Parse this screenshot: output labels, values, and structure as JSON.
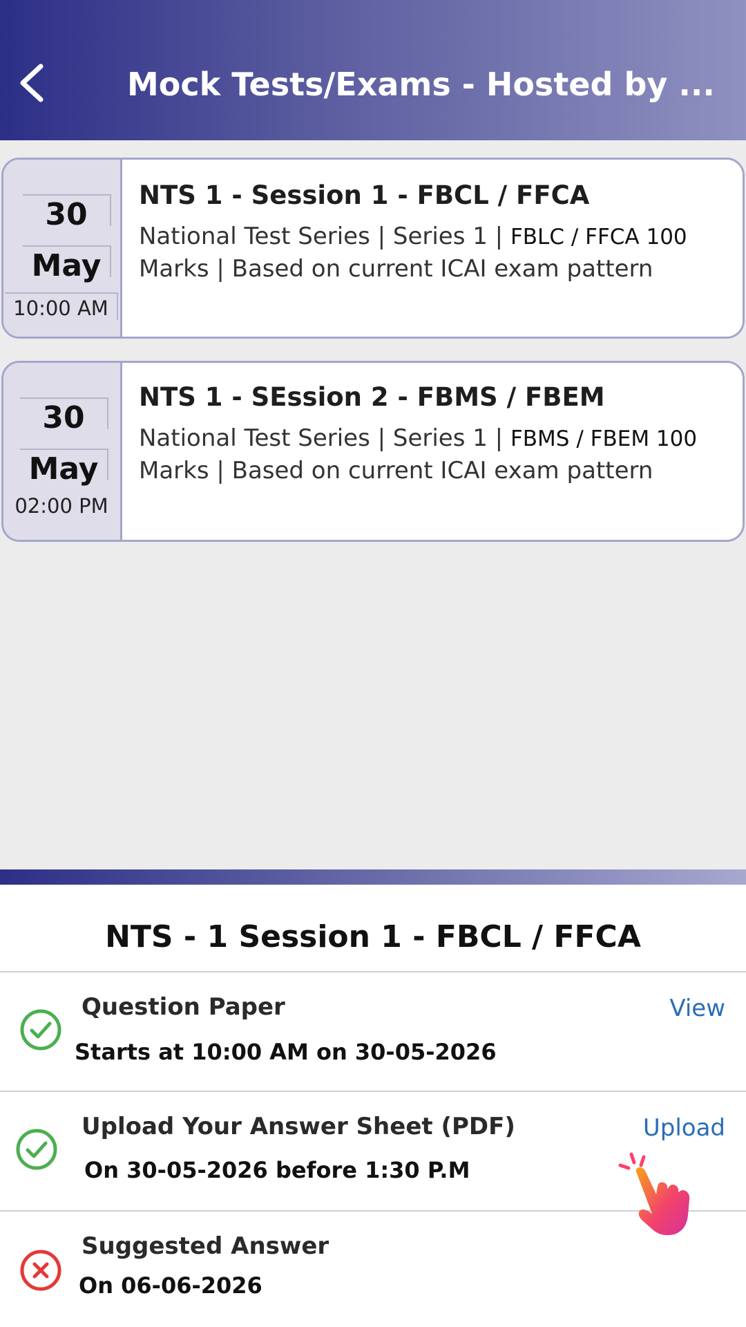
{
  "header": {
    "title": "Mock Tests/Exams - Hosted by ...",
    "gradient_start": "#2c2f86",
    "gradient_end": "#8f91c0"
  },
  "exams": [
    {
      "day": "30",
      "month": "May",
      "time": "10:00 AM",
      "title": "NTS 1 -  Session 1 - FBCL / FFCA",
      "desc_part1": "National Test Series | Series 1 | ",
      "desc_part2": "FBLC / FFCA 100",
      "desc_part3": "Marks | Based on current ICAI exam pattern"
    },
    {
      "day": "30",
      "month": "May",
      "time": "02:00 PM",
      "title": "NTS 1 - SEssion 2 - FBMS / FBEM",
      "desc_part1": "National Test Series | Series 1 | ",
      "desc_part2": "FBMS / FBEM 100",
      "desc_part3": "Marks | Based on current ICAI exam pattern"
    }
  ],
  "sheet": {
    "title": "NTS - 1 Session 1 - FBCL / FFCA",
    "items": [
      {
        "icon": "check-circle-icon",
        "title": "Question Paper",
        "subtitle": "Starts at 10:00 AM on 30-05-2026",
        "action": "View"
      },
      {
        "icon": "check-circle-icon",
        "title": "Upload Your Answer Sheet (PDF)",
        "subtitle": "On 30-05-2026 before 1:30 P.M",
        "action": "Upload"
      },
      {
        "icon": "x-circle-icon",
        "title": "Suggested Answer",
        "subtitle": "On 06-06-2026",
        "action": ""
      }
    ]
  },
  "colors": {
    "check": "#4caf50",
    "cross": "#e53935",
    "link": "#2a6db5",
    "card_border": "#a4a6cc"
  }
}
